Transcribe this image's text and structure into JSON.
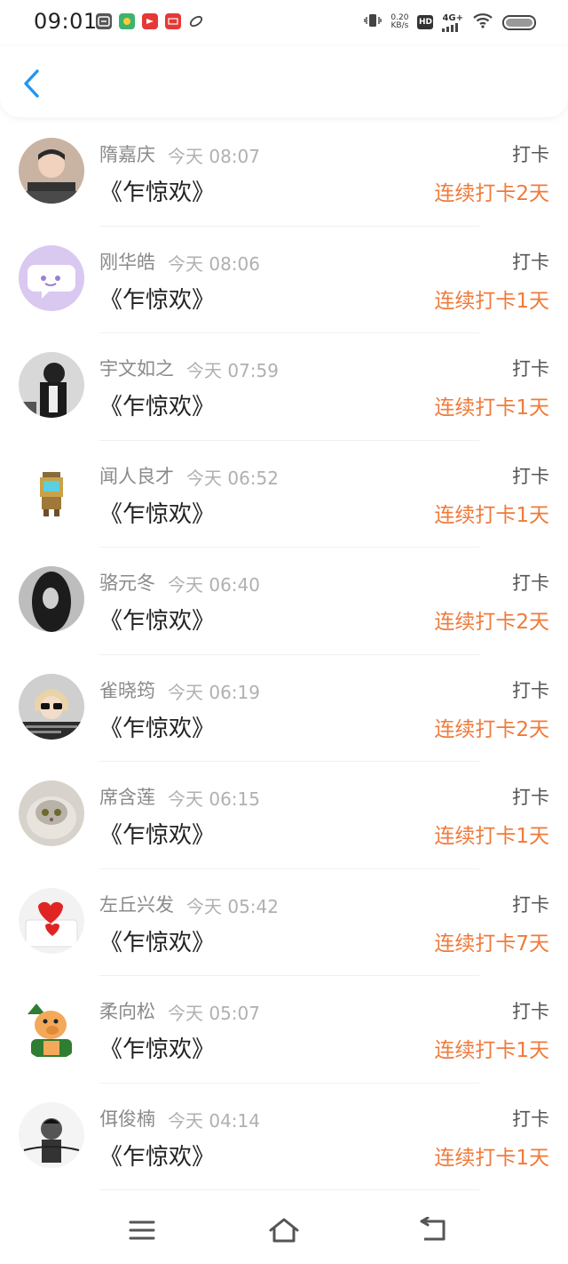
{
  "status_bar": {
    "time": "09:01",
    "net_speed_value": "0.20",
    "net_speed_unit": "KB/s",
    "hd_label": "HD",
    "network_type": "4G+",
    "notification_icons": [
      "weather-icon",
      "app-store-icon",
      "video-app-icon",
      "news-app-icon",
      "browser-icon"
    ]
  },
  "header": {
    "back_icon": "chevron-left-icon",
    "accent_color": "#2196f3"
  },
  "colors": {
    "streak": "#f07a3a",
    "name": "#8a8a8a",
    "time": "#b0b0b0"
  },
  "checkins": [
    {
      "name": "隋嘉庆",
      "time": "今天 08:07",
      "title": "《乍惊欢》",
      "action": "打卡",
      "streak": "连续打卡2天",
      "avatar": "photo-boy"
    },
    {
      "name": "刚华皓",
      "time": "今天 08:06",
      "title": "《乍惊欢》",
      "action": "打卡",
      "streak": "连续打卡1天",
      "avatar": "default-chat"
    },
    {
      "name": "宇文如之",
      "time": "今天 07:59",
      "title": "《乍惊欢》",
      "action": "打卡",
      "streak": "连续打卡1天",
      "avatar": "photo-dark"
    },
    {
      "name": "闻人良才",
      "time": "今天 06:52",
      "title": "《乍惊欢》",
      "action": "打卡",
      "streak": "连续打卡1天",
      "avatar": "pixel-robot"
    },
    {
      "name": "骆元冬",
      "time": "今天 06:40",
      "title": "《乍惊欢》",
      "action": "打卡",
      "streak": "连续打卡2天",
      "avatar": "photo-hair"
    },
    {
      "name": "雀晓筠",
      "time": "今天 06:19",
      "title": "《乍惊欢》",
      "action": "打卡",
      "streak": "连续打卡2天",
      "avatar": "photo-sunglasses"
    },
    {
      "name": "席含莲",
      "time": "今天 06:15",
      "title": "《乍惊欢》",
      "action": "打卡",
      "streak": "连续打卡1天",
      "avatar": "photo-cat"
    },
    {
      "name": "左丘兴发",
      "time": "今天 05:42",
      "title": "《乍惊欢》",
      "action": "打卡",
      "streak": "连续打卡7天",
      "avatar": "photo-hearts"
    },
    {
      "name": "柔向松",
      "time": "今天 05:07",
      "title": "《乍惊欢》",
      "action": "打卡",
      "streak": "连续打卡1天",
      "avatar": "cartoon-pig"
    },
    {
      "name": "佴俊楠",
      "time": "今天 04:14",
      "title": "《乍惊欢》",
      "action": "打卡",
      "streak": "连续打卡1天",
      "avatar": "photo-bw"
    }
  ],
  "nav_bar": {
    "menu_icon": "menu-icon",
    "home_icon": "home-icon",
    "back_icon": "back-arrow-icon"
  }
}
